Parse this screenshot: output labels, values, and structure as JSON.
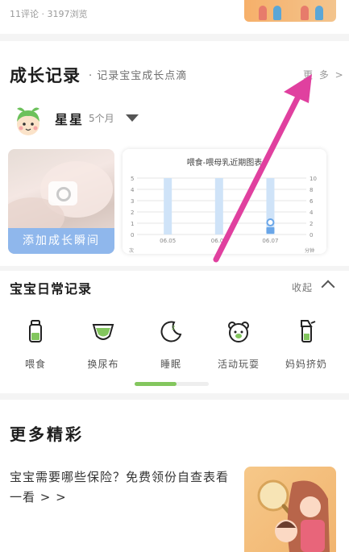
{
  "top": {
    "meta_text": "11评论 · 3197浏览"
  },
  "growth": {
    "title": "成长记录",
    "subtitle": "· 记录宝宝成长点滴",
    "more_label": "更 多 >",
    "baby_name": "星星",
    "baby_age": "5个月",
    "add_button_label": "添加成长瞬间"
  },
  "chart_data": {
    "type": "bar",
    "title": "喂食-喂母乳近期图表",
    "categories": [
      "06.05",
      "06.06",
      "06.07"
    ],
    "values": [
      5,
      5,
      5
    ],
    "ylim": [
      0,
      5
    ],
    "y_ticks": [
      "5",
      "4",
      "3",
      "2",
      "1",
      "0"
    ],
    "y2_ticks": [
      "10",
      "8",
      "6",
      "4",
      "2",
      "0"
    ],
    "xlabel_left": "次",
    "xlabel_right": "分钟",
    "grid": true,
    "colors": {
      "bar": "#cfe3f8",
      "accent": "#6aa6e8"
    }
  },
  "daily": {
    "title": "宝宝日常记录",
    "collapse_label": "收起",
    "items": [
      {
        "label": "喂食",
        "icon": "bottle-icon"
      },
      {
        "label": "换尿布",
        "icon": "diaper-icon"
      },
      {
        "label": "睡眠",
        "icon": "moon-icon"
      },
      {
        "label": "活动玩耍",
        "icon": "bear-icon"
      },
      {
        "label": "妈妈挤奶",
        "icon": "breast-pump-icon"
      }
    ],
    "scroll_progress": 0.56
  },
  "more": {
    "title": "更多精彩",
    "article_title": "宝宝需要哪些保险？免费领份自查表看一看 > >"
  },
  "colors": {
    "accent_green": "#83c65e",
    "button_blue": "#8fb7ec",
    "arrow_pink": "#e0409f"
  }
}
